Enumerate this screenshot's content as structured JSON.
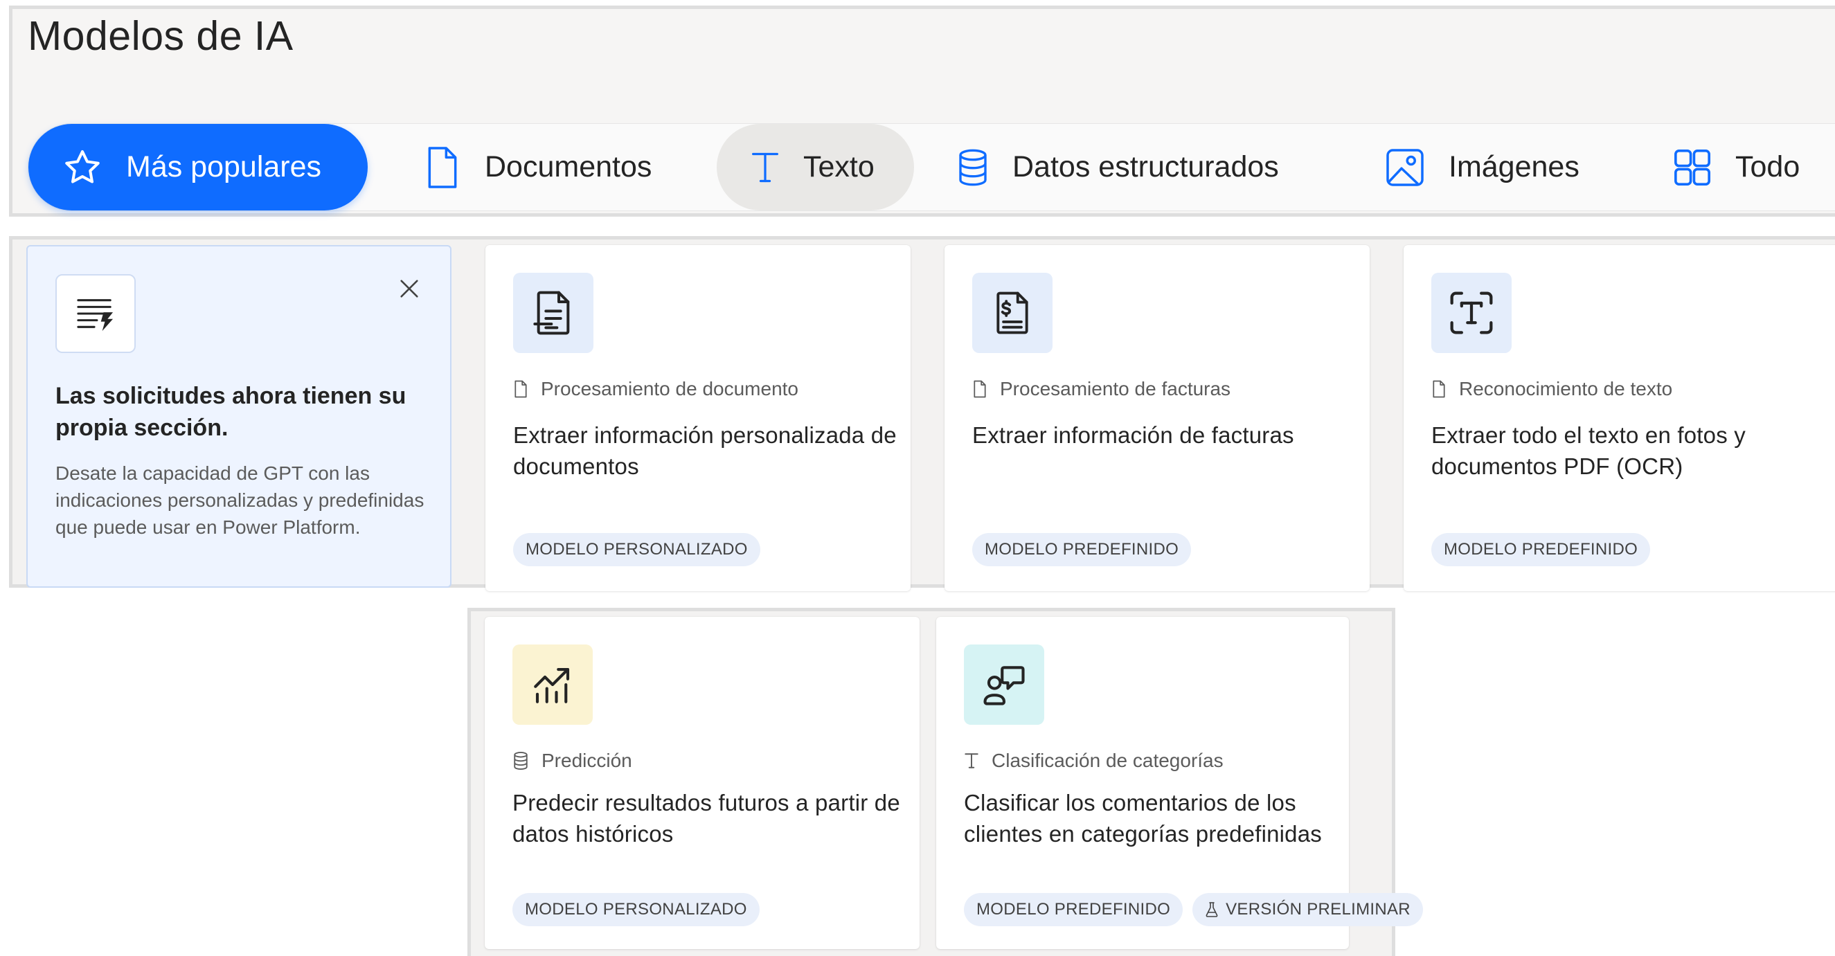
{
  "page": {
    "title": "Modelos de IA"
  },
  "tabs": [
    {
      "label": "Más populares",
      "icon": "star-icon",
      "active": true
    },
    {
      "label": "Documentos",
      "icon": "document-icon"
    },
    {
      "label": "Texto",
      "icon": "text-icon"
    },
    {
      "label": "Datos estructurados",
      "icon": "database-icon"
    },
    {
      "label": "Imágenes",
      "icon": "image-icon"
    },
    {
      "label": "Todo",
      "icon": "grid-icon"
    }
  ],
  "notice": {
    "icon": "prompt-flash-icon",
    "title": "Las solicitudes ahora tienen su propia sección.",
    "body": "Desate la capacidad de GPT con las indicaciones personalizadas y predefinidas que puede usar en Power Platform.",
    "close_icon": "close-icon"
  },
  "cards": [
    {
      "icon": "document-text-icon",
      "category": "Procesamiento de documento",
      "category_icon": "document-icon",
      "title": "Extraer información personalizada de documentos",
      "badges": [
        "MODELO PERSONALIZADO"
      ]
    },
    {
      "icon": "invoice-icon",
      "category": "Procesamiento de facturas",
      "category_icon": "document-icon",
      "title": "Extraer información de facturas",
      "badges": [
        "MODELO PREDEFINIDO"
      ]
    },
    {
      "icon": "text-scan-icon",
      "category": "Reconocimiento de texto",
      "category_icon": "document-icon",
      "title": "Extraer todo el texto en fotos y documentos PDF (OCR)",
      "badges": [
        "MODELO PREDEFINIDO"
      ]
    },
    {
      "icon": "chart-trend-icon",
      "category": "Predicción",
      "category_icon": "database-icon",
      "title": "Predecir resultados futuros a partir de datos históricos",
      "badges": [
        "MODELO PERSONALIZADO"
      ]
    },
    {
      "icon": "person-feedback-icon",
      "category": "Clasificación de categorías",
      "category_icon": "text-icon",
      "title": "Clasificar los comentarios de los clientes en categorías predefinidas",
      "badges": [
        "MODELO PREDEFINIDO",
        "VERSIÓN PRELIMINAR"
      ]
    }
  ],
  "colors": {
    "accent": "#0f6cff",
    "badge_bg": "#e9effa",
    "tile_blue": "#e4edfb",
    "tile_yellow": "#fbf3d2",
    "tile_teal": "#d6f3f4"
  }
}
